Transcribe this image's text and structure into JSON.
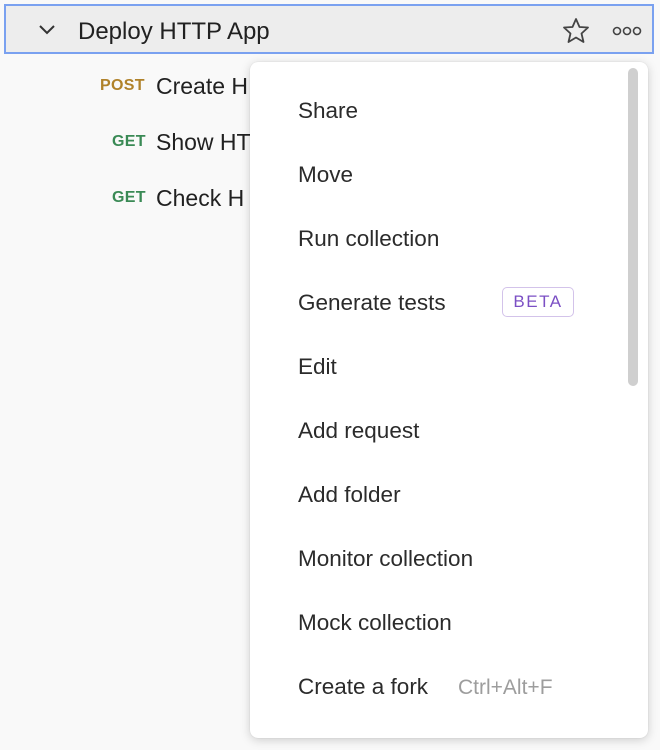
{
  "collection": {
    "title": "Deploy HTTP App"
  },
  "requests": [
    {
      "method": "POST",
      "name": "Create H"
    },
    {
      "method": "GET",
      "name": "Show HT"
    },
    {
      "method": "GET",
      "name": "Check H"
    }
  ],
  "menu": {
    "items": [
      {
        "label": "Share"
      },
      {
        "label": "Move"
      },
      {
        "label": "Run collection"
      },
      {
        "label": "Generate tests",
        "badge": "BETA"
      },
      {
        "label": "Edit"
      },
      {
        "label": "Add request"
      },
      {
        "label": "Add folder"
      },
      {
        "label": "Monitor collection"
      },
      {
        "label": "Mock collection"
      },
      {
        "label": "Create a fork",
        "shortcut": "Ctrl+Alt+F"
      }
    ]
  },
  "colors": {
    "header_border": "#7aa1f0",
    "post_method": "#b0822a",
    "get_method": "#3a8a55",
    "beta_badge": "#7b4fc4"
  },
  "icons": {
    "caret": "chevron-down-icon",
    "star": "star-icon",
    "more": "more-options-icon"
  }
}
